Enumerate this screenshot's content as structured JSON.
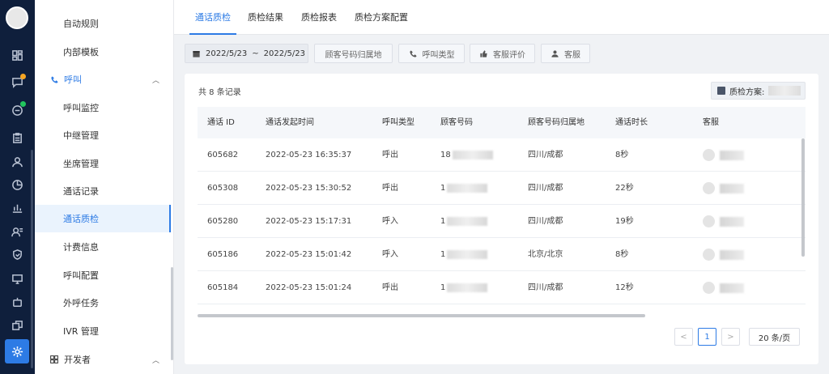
{
  "sidebar": {
    "items": [
      {
        "label": "自动规则"
      },
      {
        "label": "内部模板"
      },
      {
        "label": "呼叫"
      },
      {
        "label": "呼叫监控"
      },
      {
        "label": "中继管理"
      },
      {
        "label": "坐席管理"
      },
      {
        "label": "通话记录"
      },
      {
        "label": "通话质检"
      },
      {
        "label": "计费信息"
      },
      {
        "label": "呼叫配置"
      },
      {
        "label": "外呼任务"
      },
      {
        "label": "IVR 管理"
      },
      {
        "label": "开发者"
      }
    ]
  },
  "tabs": [
    "通话质检",
    "质检结果",
    "质检报表",
    "质检方案配置"
  ],
  "filters": {
    "date_from": "2022/5/23",
    "date_sep": "~",
    "date_to": "2022/5/23",
    "location": "顾客号码归属地",
    "call_type": "呼叫类型",
    "rating": "客服评价",
    "agent": "客服"
  },
  "summary": {
    "count_text": "共 8 条记录",
    "scheme_label": "质检方案:"
  },
  "table": {
    "headers": [
      "通话 ID",
      "通话发起时间",
      "呼叫类型",
      "顾客号码",
      "顾客号码归属地",
      "通话时长",
      "客服"
    ],
    "rows": [
      [
        "605682",
        "2022-05-23 16:35:37",
        "呼出",
        "18",
        "四川/成都",
        "8秒",
        ""
      ],
      [
        "605308",
        "2022-05-23 15:30:52",
        "呼出",
        "1",
        "四川/成都",
        "22秒",
        ""
      ],
      [
        "605280",
        "2022-05-23 15:17:31",
        "呼入",
        "1",
        "四川/成都",
        "19秒",
        ""
      ],
      [
        "605186",
        "2022-05-23 15:01:42",
        "呼入",
        "1",
        "北京/北京",
        "8秒",
        ""
      ],
      [
        "605184",
        "2022-05-23 15:01:24",
        "呼出",
        "1",
        "四川/成都",
        "12秒",
        ""
      ]
    ]
  },
  "pagination": {
    "prev": "<",
    "page": "1",
    "next": ">",
    "size": "20 条/页"
  },
  "colors": {
    "accent": "#2d7be5",
    "rail": "#0f1f3c"
  },
  "icons": [
    "dashboard-icon",
    "chat-icon",
    "message-icon",
    "clipboard-icon",
    "user-icon",
    "chart-icon",
    "bar-chart-icon",
    "contacts-icon",
    "shield-icon",
    "monitor-icon",
    "robot-icon",
    "apps-icon",
    "settings-icon"
  ]
}
